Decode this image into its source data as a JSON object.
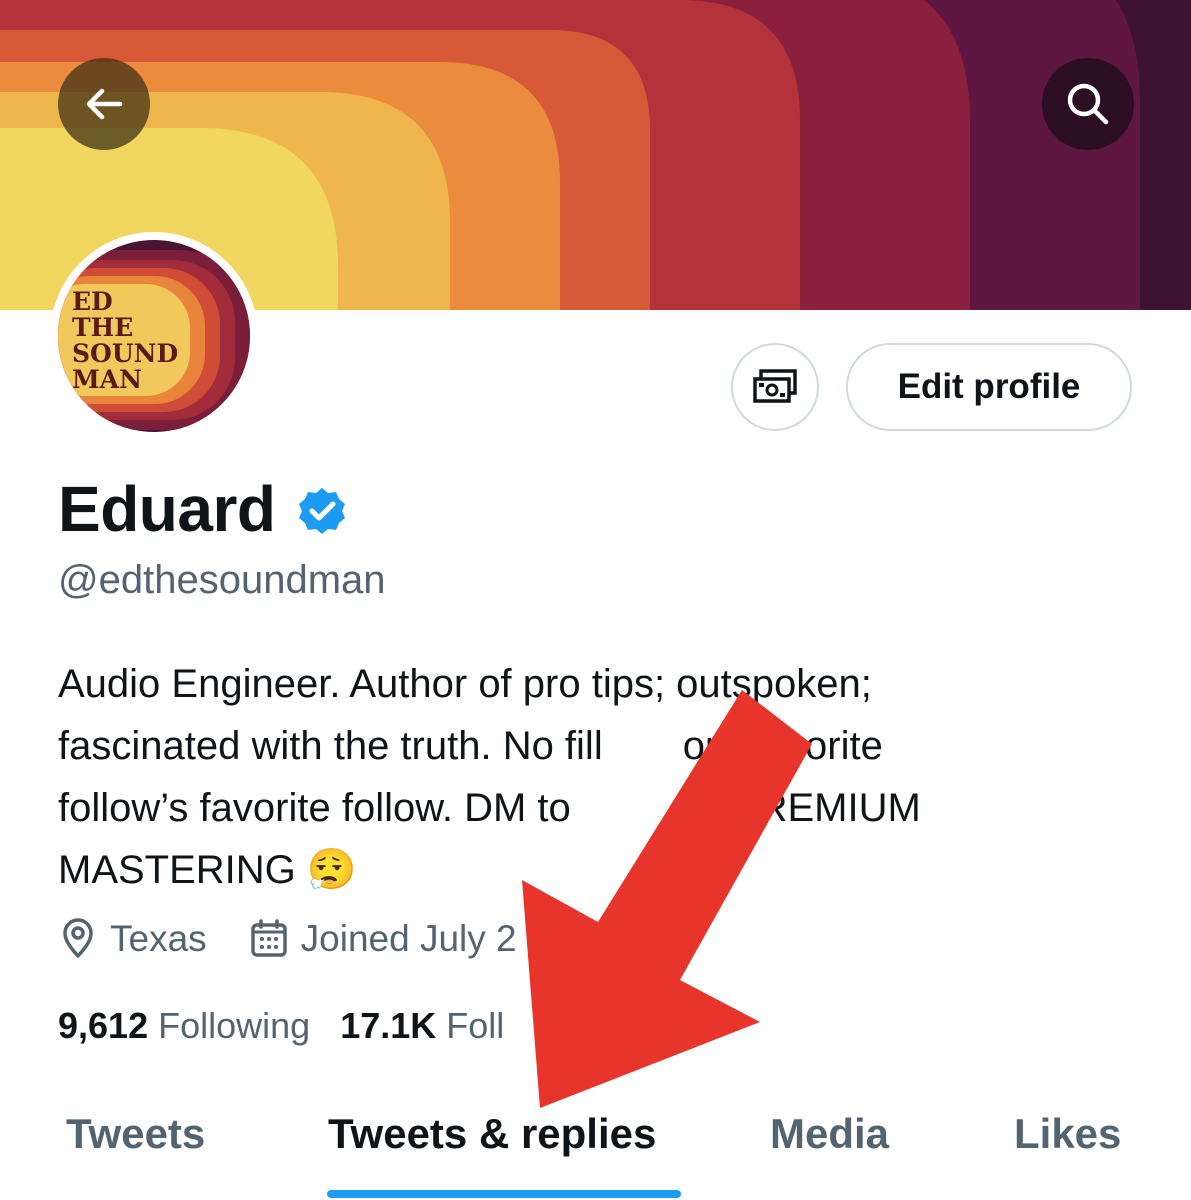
{
  "colors": {
    "accent": "#1d9bf0",
    "arrow": "#e8352b",
    "text_primary": "#0f1419",
    "text_secondary": "#536471",
    "banner_bands": [
      "#f1d660",
      "#f0b64e",
      "#eb8b3d",
      "#d75a38",
      "#b4333a",
      "#8a1f3e",
      "#5e1740",
      "#3e1233"
    ]
  },
  "header": {
    "back_icon": "arrow-left-icon",
    "search_icon": "search-icon"
  },
  "avatar": {
    "logo_lines": [
      "ED",
      "THE",
      "SOUND",
      "MAN"
    ]
  },
  "actions": {
    "tip_icon": "money-icon",
    "edit_profile_label": "Edit profile"
  },
  "profile": {
    "name": "Eduard",
    "verified_icon": "verified-badge-icon",
    "handle": "@edthesoundman",
    "bio_lines": [
      "Audio Engineer. Author of pro tips; outspoken;",
      "fascinated with the truth. No fill",
      "our favorite",
      "follow’s favorite follow. DM to",
      "ck PREMIUM",
      "MASTERING"
    ],
    "bio_emoji": "😮‍💨",
    "location": "Texas",
    "location_icon": "location-pin-icon",
    "joined": "Joined July 2",
    "joined_icon": "calendar-icon"
  },
  "stats": {
    "following_count": "9,612",
    "following_label": "Following",
    "followers_count": "17.1K",
    "followers_label": "Foll"
  },
  "tabs": [
    {
      "label": "Tweets",
      "active": false
    },
    {
      "label": "Tweets & replies",
      "active": true
    },
    {
      "label": "Media",
      "active": false
    },
    {
      "label": "Likes",
      "active": false
    }
  ]
}
